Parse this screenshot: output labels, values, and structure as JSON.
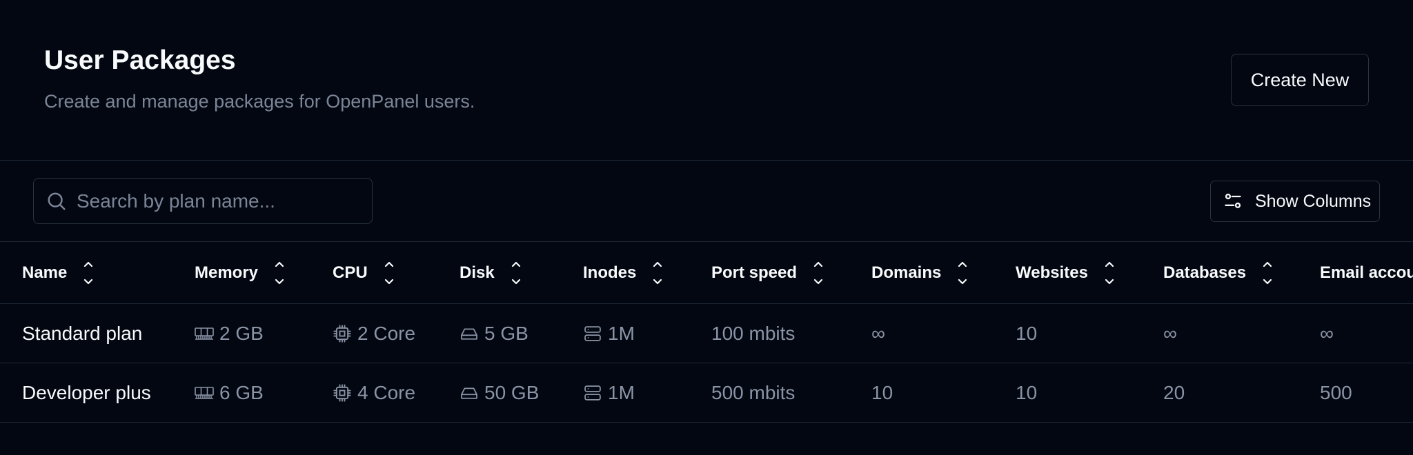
{
  "header": {
    "title": "User Packages",
    "subtitle": "Create and manage packages for OpenPanel users.",
    "create_label": "Create New"
  },
  "toolbar": {
    "search_placeholder": "Search by plan name...",
    "search_value": "",
    "show_columns_label": "Show Columns"
  },
  "table": {
    "columns": [
      "Name",
      "Memory",
      "CPU",
      "Disk",
      "Inodes",
      "Port speed",
      "Domains",
      "Websites",
      "Databases",
      "Email accou"
    ],
    "rows": [
      {
        "name": "Standard plan",
        "memory": "2 GB",
        "cpu": "2 Core",
        "disk": "5 GB",
        "inodes": "1M",
        "port_speed": "100 mbits",
        "domains": "∞",
        "websites": "10",
        "databases": "∞",
        "email": "∞"
      },
      {
        "name": "Developer plus",
        "memory": "6 GB",
        "cpu": "4 Core",
        "disk": "50 GB",
        "inodes": "1M",
        "port_speed": "500 mbits",
        "domains": "10",
        "websites": "10",
        "databases": "20",
        "email": "500"
      }
    ]
  },
  "icons": {
    "search": "search-icon",
    "columns": "sliders-icon",
    "sort": "chevrons-up-down-icon",
    "memory": "memory-stick-icon",
    "cpu": "cpu-icon",
    "disk": "hard-drive-icon",
    "inodes": "server-icon"
  },
  "colors": {
    "background": "#030711",
    "border": "#1f2937",
    "muted_text": "#8a94a6",
    "text": "#f8fafc"
  }
}
